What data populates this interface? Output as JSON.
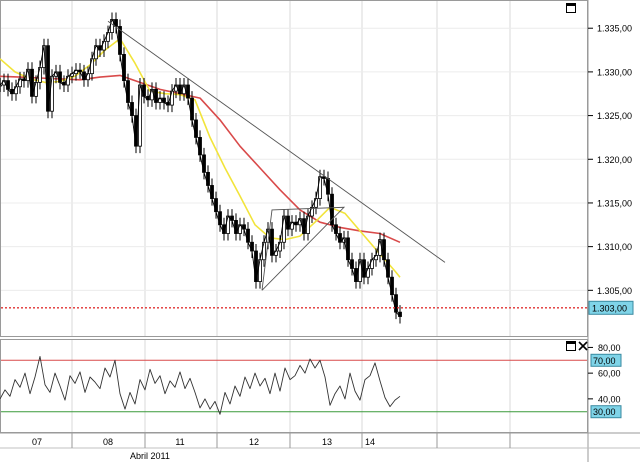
{
  "chart_data": [
    {
      "type": "line",
      "title": "",
      "price_scale": {
        "min": 1.3,
        "max": 1.338,
        "ticks": [
          1.305,
          1.31,
          1.315,
          1.32,
          1.325,
          1.33,
          1.335
        ],
        "tick_labels": [
          "1.305,00",
          "1.310,00",
          "1.315,00",
          "1.320,00",
          "1.325,00",
          "1.330,00",
          "1.335,00"
        ]
      },
      "current_price_label": "1.303,00",
      "current_price": 1.303,
      "x_axis": {
        "day_labels": [
          "07",
          "08",
          "11",
          "12",
          "13",
          "14"
        ],
        "month_label": "Abril 2011"
      },
      "series": [
        {
          "kind": "candlestick-price",
          "color": "#000000",
          "x": [
            0,
            4,
            8,
            12,
            16,
            20,
            24,
            28,
            32,
            36,
            40,
            44,
            48,
            52,
            56,
            60,
            64,
            68,
            72,
            76,
            80,
            84,
            88,
            92,
            96,
            100,
            104,
            108,
            112,
            116,
            120,
            124,
            128,
            132,
            136,
            140,
            144,
            148,
            152,
            156,
            160,
            164,
            168,
            172,
            176,
            180,
            184,
            188,
            192,
            196,
            200,
            204,
            208,
            212,
            216,
            220,
            224,
            228,
            232,
            236,
            240,
            244,
            248,
            252,
            256,
            260,
            264,
            268,
            272,
            276,
            280,
            284,
            288,
            292,
            296,
            300,
            304,
            308,
            312,
            316,
            320,
            324,
            328,
            332,
            336,
            340,
            344,
            348,
            352,
            356,
            360,
            364,
            368,
            372,
            376,
            380,
            384,
            388,
            392,
            396,
            400
          ],
          "values": [
            1.3285,
            1.329,
            1.328,
            1.3275,
            1.3283,
            1.3292,
            1.329,
            1.3303,
            1.3272,
            1.3288,
            1.3305,
            1.333,
            1.3255,
            1.3295,
            1.33,
            1.3288,
            1.3285,
            1.3295,
            1.3298,
            1.3302,
            1.33,
            1.3291,
            1.3298,
            1.3315,
            1.333,
            1.3325,
            1.3335,
            1.3345,
            1.336,
            1.3352,
            1.332,
            1.329,
            1.3265,
            1.325,
            1.3215,
            1.3285,
            1.3272,
            1.3268,
            1.328,
            1.3265,
            1.327,
            1.3265,
            1.3262,
            1.3278,
            1.3285,
            1.3275,
            1.3285,
            1.327,
            1.3245,
            1.3225,
            1.3205,
            1.3185,
            1.317,
            1.3155,
            1.314,
            1.3125,
            1.3115,
            1.3135,
            1.313,
            1.3115,
            1.3125,
            1.312,
            1.3105,
            1.3095,
            1.306,
            1.3085,
            1.3105,
            1.312,
            1.309,
            1.3095,
            1.3105,
            1.3135,
            1.312,
            1.3128,
            1.3125,
            1.3132,
            1.3115,
            1.3135,
            1.3145,
            1.3155,
            1.318,
            1.3178,
            1.316,
            1.3125,
            1.3115,
            1.3105,
            1.311,
            1.3085,
            1.3075,
            1.306,
            1.3085,
            1.3065,
            1.3075,
            1.3085,
            1.309,
            1.3108,
            1.3085,
            1.3065,
            1.3045,
            1.3025,
            1.302
          ]
        },
        {
          "kind": "moving-average-fast",
          "color": "#f2e43b",
          "x": [
            0,
            15,
            30,
            45,
            60,
            75,
            90,
            105,
            120,
            135,
            150,
            165,
            180,
            195,
            210,
            225,
            240,
            255,
            270,
            285,
            300,
            315,
            330,
            345,
            360,
            375,
            385,
            395,
            400
          ],
          "values": [
            1.3315,
            1.33,
            1.3292,
            1.3288,
            1.3289,
            1.3295,
            1.3308,
            1.3325,
            1.3338,
            1.331,
            1.3278,
            1.3275,
            1.3274,
            1.3268,
            1.3225,
            1.319,
            1.3158,
            1.3125,
            1.311,
            1.3108,
            1.3112,
            1.3128,
            1.3145,
            1.3138,
            1.3118,
            1.3098,
            1.3085,
            1.3072,
            1.3065
          ]
        },
        {
          "kind": "moving-average-slow",
          "color": "#d94a4a",
          "x": [
            0,
            20,
            40,
            60,
            80,
            100,
            120,
            140,
            160,
            180,
            200,
            220,
            240,
            260,
            280,
            300,
            320,
            340,
            360,
            380,
            400
          ],
          "values": [
            1.3295,
            1.3294,
            1.3293,
            1.3292,
            1.3291,
            1.3294,
            1.3296,
            1.3288,
            1.328,
            1.3275,
            1.327,
            1.3245,
            1.3215,
            1.319,
            1.3165,
            1.3142,
            1.3128,
            1.3122,
            1.3118,
            1.3115,
            1.3105
          ]
        }
      ],
      "trendlines": [
        {
          "kind": "resistance",
          "points": [
            [
              108,
              1.3358
            ],
            [
              445,
              1.3082
            ]
          ]
        },
        {
          "kind": "triangle",
          "points": [
            [
              262,
              1.305
            ],
            [
              344,
              1.3145
            ],
            [
              272,
              1.3142
            ],
            [
              262,
              1.305
            ]
          ]
        }
      ]
    },
    {
      "type": "line",
      "title": "",
      "ylim": [
        15,
        85
      ],
      "tick_labels": [
        "80,00",
        "60,00",
        "40,00"
      ],
      "ticks": [
        80,
        60,
        40
      ],
      "levels": [
        {
          "value": 70,
          "label": "70,00",
          "color": "#d94a4a"
        },
        {
          "value": 30,
          "label": "30,00",
          "color": "#3a9a3a"
        }
      ],
      "series": [
        {
          "kind": "oscillator",
          "color": "#333333",
          "x": [
            0,
            5,
            10,
            15,
            20,
            25,
            30,
            35,
            40,
            45,
            50,
            55,
            60,
            65,
            70,
            75,
            80,
            85,
            90,
            95,
            100,
            105,
            110,
            115,
            120,
            125,
            130,
            135,
            140,
            145,
            150,
            155,
            160,
            165,
            170,
            175,
            180,
            185,
            190,
            195,
            200,
            205,
            210,
            215,
            220,
            225,
            230,
            235,
            240,
            245,
            250,
            255,
            260,
            265,
            270,
            275,
            280,
            285,
            290,
            295,
            300,
            305,
            310,
            315,
            320,
            325,
            330,
            335,
            340,
            345,
            350,
            355,
            360,
            365,
            370,
            375,
            380,
            385,
            390,
            395,
            400
          ],
          "values": [
            40,
            47,
            42,
            55,
            49,
            60,
            44,
            57,
            73,
            51,
            45,
            60,
            50,
            39,
            58,
            52,
            61,
            45,
            57,
            53,
            48,
            64,
            57,
            70,
            44,
            32,
            45,
            36,
            55,
            47,
            63,
            52,
            58,
            44,
            54,
            49,
            61,
            48,
            56,
            45,
            33,
            40,
            32,
            38,
            28,
            45,
            36,
            50,
            42,
            57,
            48,
            60,
            50,
            56,
            44,
            60,
            46,
            64,
            55,
            58,
            66,
            60,
            71,
            64,
            70,
            57,
            35,
            44,
            50,
            40,
            60,
            46,
            39,
            55,
            58,
            68,
            54,
            41,
            34,
            39,
            42
          ]
        }
      ]
    }
  ]
}
